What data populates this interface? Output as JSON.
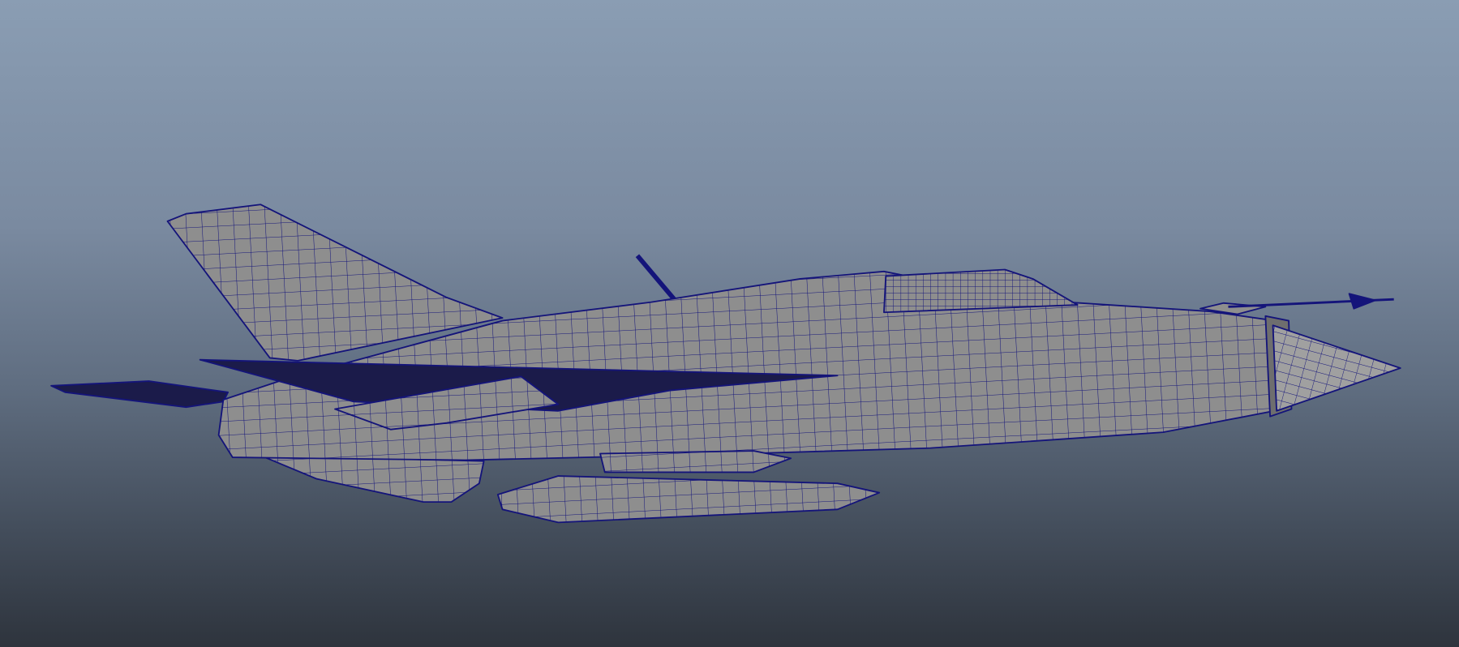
{
  "viewport": {
    "background_top": "#8a9db3",
    "background_bottom": "#2e343d",
    "model": {
      "surface_color": "#8e8e8e",
      "wireframe_color": "#14147a",
      "wing_color": "#1b1b4a"
    }
  }
}
